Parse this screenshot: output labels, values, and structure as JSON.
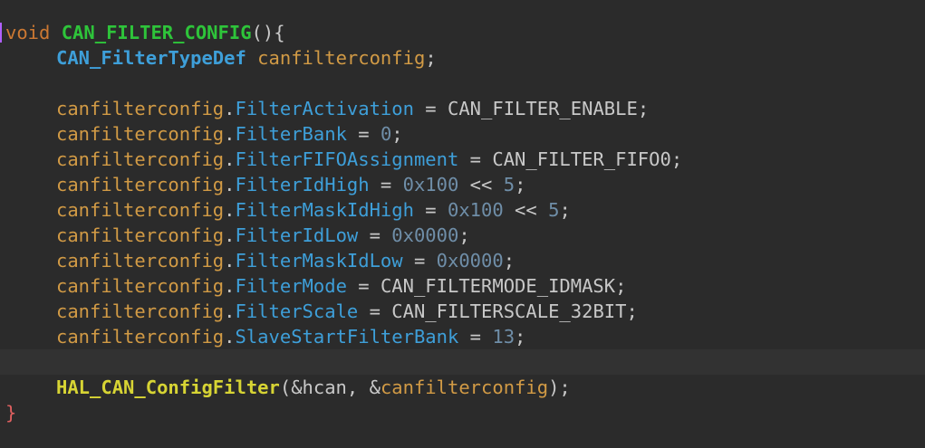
{
  "code": {
    "signature": {
      "keyword": "void",
      "function_name": "CAN_FILTER_CONFIG",
      "parens": "()",
      "open_brace": "{"
    },
    "declaration": {
      "type": "CAN_FilterTypeDef",
      "variable": "canfilterconfig",
      "terminator": ";"
    },
    "assignments": [
      {
        "object": "canfilterconfig",
        "field": "FilterActivation",
        "op": " = ",
        "value": "CAN_FILTER_ENABLE",
        "value_kind": "plain",
        "extra_op": "",
        "extra_value": "",
        "end": ";"
      },
      {
        "object": "canfilterconfig",
        "field": "FilterBank",
        "op": " = ",
        "value": "0",
        "value_kind": "num",
        "extra_op": "",
        "extra_value": "",
        "end": ";"
      },
      {
        "object": "canfilterconfig",
        "field": "FilterFIFOAssignment",
        "op": " = ",
        "value": "CAN_FILTER_FIFO0",
        "value_kind": "plain",
        "extra_op": "",
        "extra_value": "",
        "end": ";"
      },
      {
        "object": "canfilterconfig",
        "field": "FilterIdHigh",
        "op": " = ",
        "value": "0x100",
        "value_kind": "num",
        "extra_op": " << ",
        "extra_value": "5",
        "end": ";"
      },
      {
        "object": "canfilterconfig",
        "field": "FilterMaskIdHigh",
        "op": " = ",
        "value": "0x100",
        "value_kind": "num",
        "extra_op": " << ",
        "extra_value": "5",
        "end": ";"
      },
      {
        "object": "canfilterconfig",
        "field": "FilterIdLow",
        "op": " = ",
        "value": "0x0000",
        "value_kind": "num",
        "extra_op": "",
        "extra_value": "",
        "end": ";"
      },
      {
        "object": "canfilterconfig",
        "field": "FilterMaskIdLow",
        "op": " = ",
        "value": "0x0000",
        "value_kind": "num",
        "extra_op": "",
        "extra_value": "",
        "end": ";"
      },
      {
        "object": "canfilterconfig",
        "field": "FilterMode",
        "op": " = ",
        "value": "CAN_FILTERMODE_IDMASK",
        "value_kind": "plain",
        "extra_op": "",
        "extra_value": "",
        "end": ";"
      },
      {
        "object": "canfilterconfig",
        "field": "FilterScale",
        "op": " = ",
        "value": "CAN_FILTERSCALE_32BIT",
        "value_kind": "plain",
        "extra_op": "",
        "extra_value": "",
        "end": ";"
      },
      {
        "object": "canfilterconfig",
        "field": "SlaveStartFilterBank",
        "op": " = ",
        "value": "13",
        "value_kind": "num",
        "extra_op": "",
        "extra_value": "",
        "end": ";"
      }
    ],
    "call": {
      "function_name": "HAL_CAN_ConfigFilter",
      "open": "(",
      "arg1": "&hcan",
      "sep": ", ",
      "amp": "&",
      "arg2": "canfilterconfig",
      "close": ");"
    },
    "close_brace": "}"
  },
  "colors": {
    "background": "#2b2b2b",
    "current_line": "#323232",
    "keyword": "#cc7832",
    "function": "#2ec43a",
    "type": "#3e9fd9",
    "variable": "#d19a45",
    "number": "#6f8ea8",
    "hal_function": "#d7d434"
  }
}
